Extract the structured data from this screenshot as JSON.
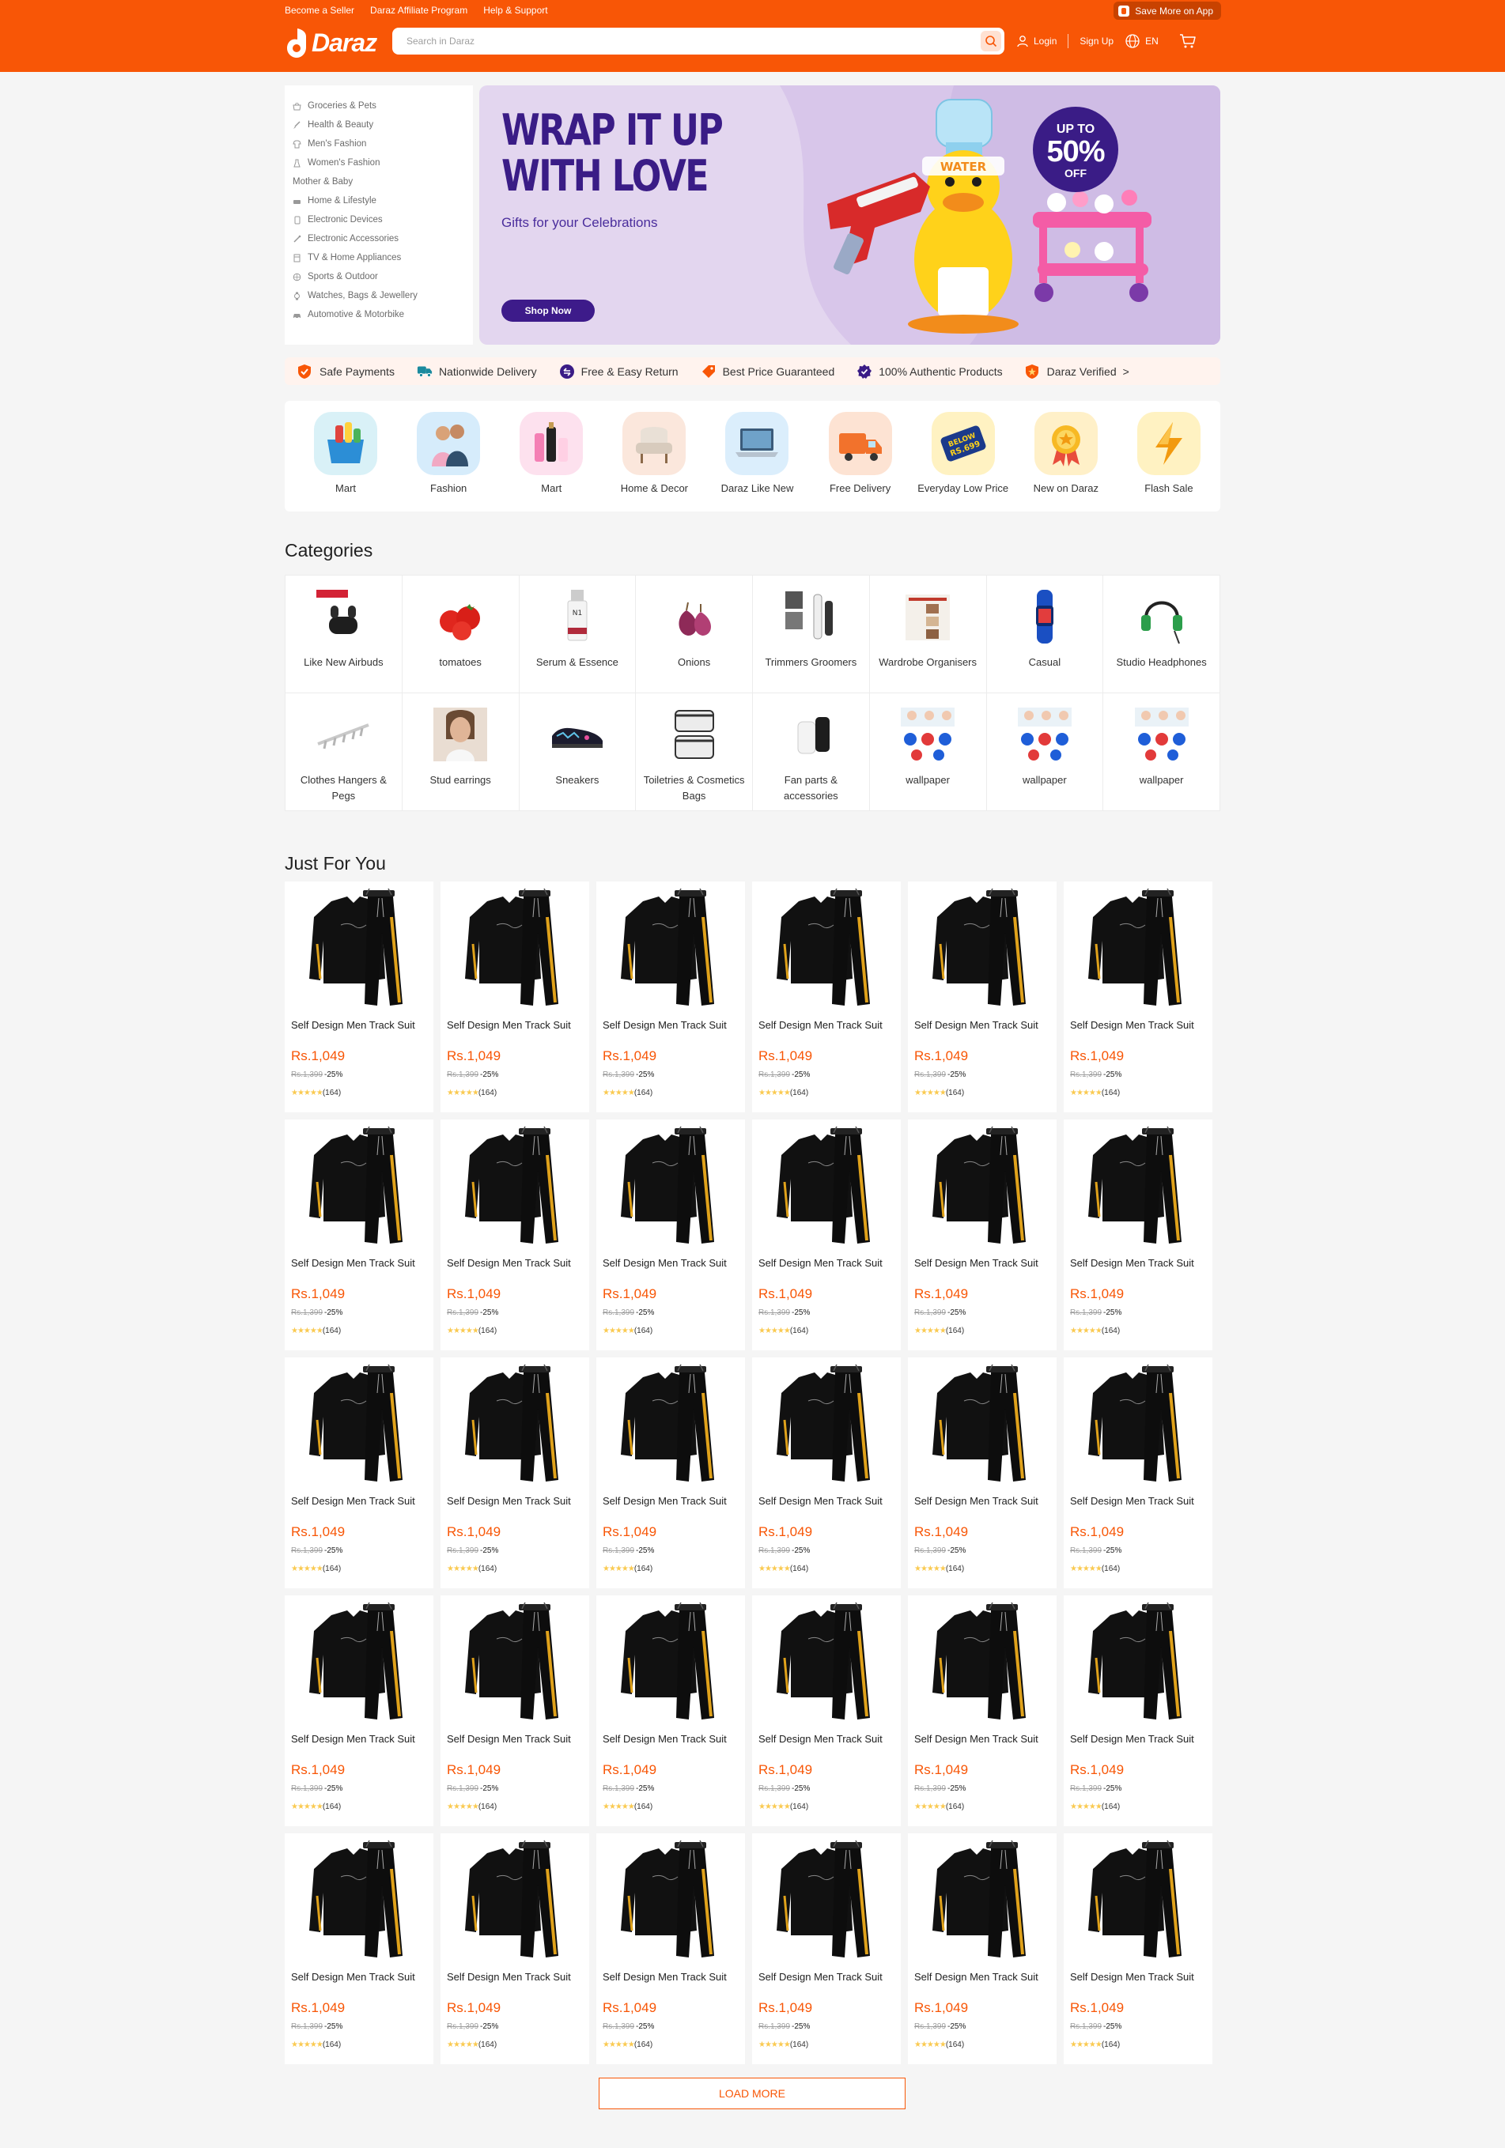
{
  "topbar": {
    "links": [
      "Become a Seller",
      "Daraz Affiliate Program",
      "Help & Support"
    ],
    "app_cta": "Save More on App"
  },
  "header": {
    "logo_text": "Daraz",
    "search_placeholder": "Search in Daraz",
    "login": "Login",
    "signup": "Sign Up",
    "language": "EN"
  },
  "category_menu": [
    {
      "label": "Groceries & Pets",
      "icon": "basket-icon"
    },
    {
      "label": "Health & Beauty",
      "icon": "brush-icon"
    },
    {
      "label": "Men's Fashion",
      "icon": "shirt-icon"
    },
    {
      "label": "Women's Fashion",
      "icon": "dress-icon"
    },
    {
      "label": "Mother & Baby",
      "icon": ""
    },
    {
      "label": "Home & Lifestyle",
      "icon": "sofa-icon"
    },
    {
      "label": "Electronic Devices",
      "icon": "phone-icon"
    },
    {
      "label": "Electronic Accessories",
      "icon": "cable-icon"
    },
    {
      "label": "TV & Home Appliances",
      "icon": "appliance-icon"
    },
    {
      "label": "Sports & Outdoor",
      "icon": "ball-icon"
    },
    {
      "label": "Watches, Bags & Jewellery",
      "icon": "watch-icon"
    },
    {
      "label": "Automotive & Motorbike",
      "icon": "car-icon"
    }
  ],
  "banner": {
    "title": "WRAP IT UP\nWITH LOVE",
    "subtitle": "Gifts for your Celebrations",
    "cta": "Shop Now",
    "badge_top": "UP TO",
    "badge_value": "50%",
    "badge_bottom": "OFF",
    "bg_color": "#e3d6ef",
    "accent": "#3a1c86"
  },
  "benefits": [
    {
      "label": "Safe Payments",
      "icon": "shield-check-icon",
      "color": "#f85606"
    },
    {
      "label": "Nationwide Delivery",
      "icon": "truck-icon",
      "color": "#1a8a9e"
    },
    {
      "label": "Free & Easy Return",
      "icon": "return-icon",
      "color": "#3a1c86"
    },
    {
      "label": "Best Price Guaranteed",
      "icon": "price-tag-icon",
      "color": "#f85606"
    },
    {
      "label": "100% Authentic Products",
      "icon": "verified-badge-icon",
      "color": "#3a1c86"
    },
    {
      "label": "Daraz Verified",
      "icon": "verified-shield-icon",
      "color": "#f85606",
      "suffix": ">"
    }
  ],
  "channels": [
    {
      "label": "Mart",
      "icon": "mart-basket-icon",
      "bg": "#d9f1f7"
    },
    {
      "label": "Fashion",
      "icon": "fashion-models-icon",
      "bg": "#d6ecfb"
    },
    {
      "label": "Mart",
      "icon": "cosmetics-icon",
      "bg": "#fde1ee"
    },
    {
      "label": "Home & Decor",
      "icon": "armchair-icon",
      "bg": "#fbe7dc"
    },
    {
      "label": "Daraz Like New",
      "icon": "laptop-icon",
      "bg": "#dbeefc"
    },
    {
      "label": "Free Delivery",
      "icon": "delivery-truck-icon",
      "bg": "#fde3d3"
    },
    {
      "label": "Everyday Low Price",
      "icon": "below-699-tag-icon",
      "bg": "#fff2c2",
      "tag_text": "BELOW\nRS.699"
    },
    {
      "label": "New on Daraz",
      "icon": "medal-icon",
      "bg": "#fff0c8"
    },
    {
      "label": "Flash Sale",
      "icon": "lightning-icon",
      "bg": "#fff2c2"
    }
  ],
  "categories": {
    "title": "Categories",
    "items": [
      {
        "label": "Like New Airbuds",
        "icon": "earbuds-icon"
      },
      {
        "label": "tomatoes",
        "icon": "tomato-icon"
      },
      {
        "label": "Serum & Essence",
        "icon": "serum-bottle-icon"
      },
      {
        "label": "Onions",
        "icon": "onion-icon"
      },
      {
        "label": "Trimmers Groomers",
        "icon": "trimmer-icon"
      },
      {
        "label": "Wardrobe Organisers",
        "icon": "wardrobe-icon"
      },
      {
        "label": "Casual",
        "icon": "smartwatch-icon"
      },
      {
        "label": "Studio Headphones",
        "icon": "gaming-headset-icon"
      },
      {
        "label": "Clothes Hangers & Pegs",
        "icon": "hanger-icon"
      },
      {
        "label": "Stud earrings",
        "icon": "earring-model-icon"
      },
      {
        "label": "Sneakers",
        "icon": "sneaker-icon"
      },
      {
        "label": "Toiletries & Cosmetics Bags",
        "icon": "cosmetic-bag-icon"
      },
      {
        "label": "Fan parts & accessories",
        "icon": "fan-part-icon"
      },
      {
        "label": "wallpaper",
        "icon": "wallpaper-icon"
      },
      {
        "label": "wallpaper",
        "icon": "wallpaper-icon"
      },
      {
        "label": "wallpaper",
        "icon": "wallpaper-icon"
      }
    ]
  },
  "just_for_you": {
    "title": "Just For You",
    "product": {
      "title": "Self Design Men Track Suit",
      "price": "Rs.1,049",
      "old_price": "Rs.1,399",
      "discount": "-25%",
      "stars": "★★★★★",
      "reviews": "(164)",
      "image": "black-tracksuit-icon"
    },
    "count": 30,
    "load_more": "LOAD MORE"
  },
  "colors": {
    "brand": "#f85606",
    "background": "#f5f5f5",
    "star": "#faca51"
  }
}
